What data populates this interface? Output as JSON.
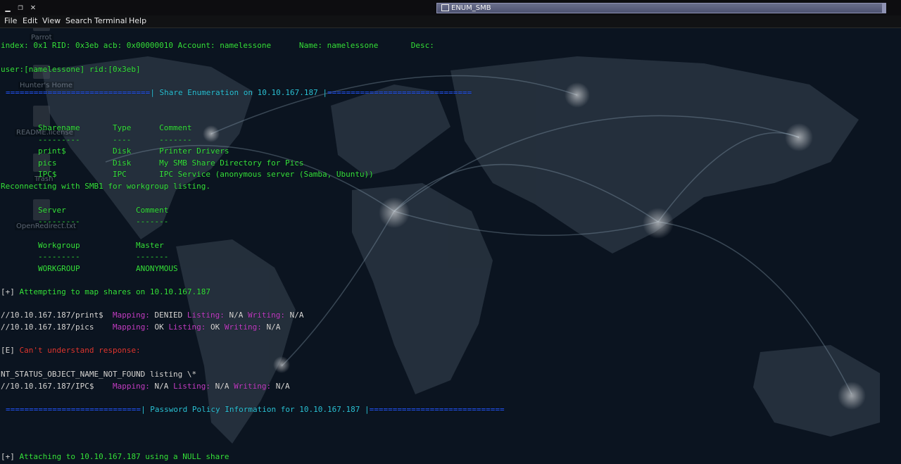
{
  "window": {
    "title": "ENUM_SMB"
  },
  "menu": [
    "File",
    "Edit",
    "View",
    "Search",
    "Terminal",
    "Help"
  ],
  "desktop_icons": [
    "Parrot",
    "Hunter's Home",
    "README.license",
    "Trash",
    "OpenRedirect.txt"
  ],
  "colors": {
    "text_green": "#36e23e",
    "cyan": "#2cc3d8",
    "magenta": "#c440c8",
    "error_red": "#e23a35"
  },
  "terminal": {
    "l1": "index: 0x1 RID: 0x3eb acb: 0x00000010 Account: namelessone      Name: namelessone       Desc:",
    "l2": "user:[namelessone] rid:[0x3eb]",
    "share_banner_left": "===============================",
    "share_banner_mid": "| Share Enumeration on 10.10.167.187 |",
    "share_banner_right": "===============================",
    "share_header": "        Sharename       Type      Comment",
    "share_sep": "        ---------       ----      -------",
    "share_rows": [
      "        print$          Disk      Printer Drivers",
      "        pics            Disk      My SMB Share Directory for Pics",
      "        IPC$            IPC       IPC Service (anonymous server (Samba, Ubuntu))"
    ],
    "reconnect": "Reconnecting with SMB1 for workgroup listing.",
    "server_header": "        Server               Comment",
    "server_sep": "        ---------            -------",
    "workgroup_header": "        Workgroup            Master",
    "workgroup_sep": "        ---------            -------",
    "workgroup_row": "        WORKGROUP            ANONYMOUS",
    "map_prefix": "[+]",
    "map_text": " Attempting to map shares on 10.10.167.187",
    "print_share": "//10.10.167.187/print$",
    "pics_share": "//10.10.167.187/pics",
    "ipc_share": "//10.10.167.187/IPC$",
    "mapping_label": "Mapping:",
    "listing_label": "Listing:",
    "writing_label": "Writing:",
    "print_mapping": " DENIED ",
    "print_listing": " N/A ",
    "print_writing": " N/A",
    "pics_mapping": " OK ",
    "pics_listing": " OK ",
    "pics_writing": " N/A",
    "ipc_mapping": " N/A ",
    "ipc_listing": " N/A ",
    "ipc_writing": " N/A",
    "err_prefix": "[E]",
    "err_text": " Can't understand response:",
    "nt_status": "NT_STATUS_OBJECT_NAME_NOT_FOUND listing \\*",
    "pass_banner_left": "=============================",
    "pass_banner_mid": "| Password Policy Information for 10.10.167.187 |",
    "pass_banner_right": "=============================",
    "attach_prefix": "[+]",
    "attach_text": " Attaching to 10.10.167.187 using a NULL share"
  }
}
